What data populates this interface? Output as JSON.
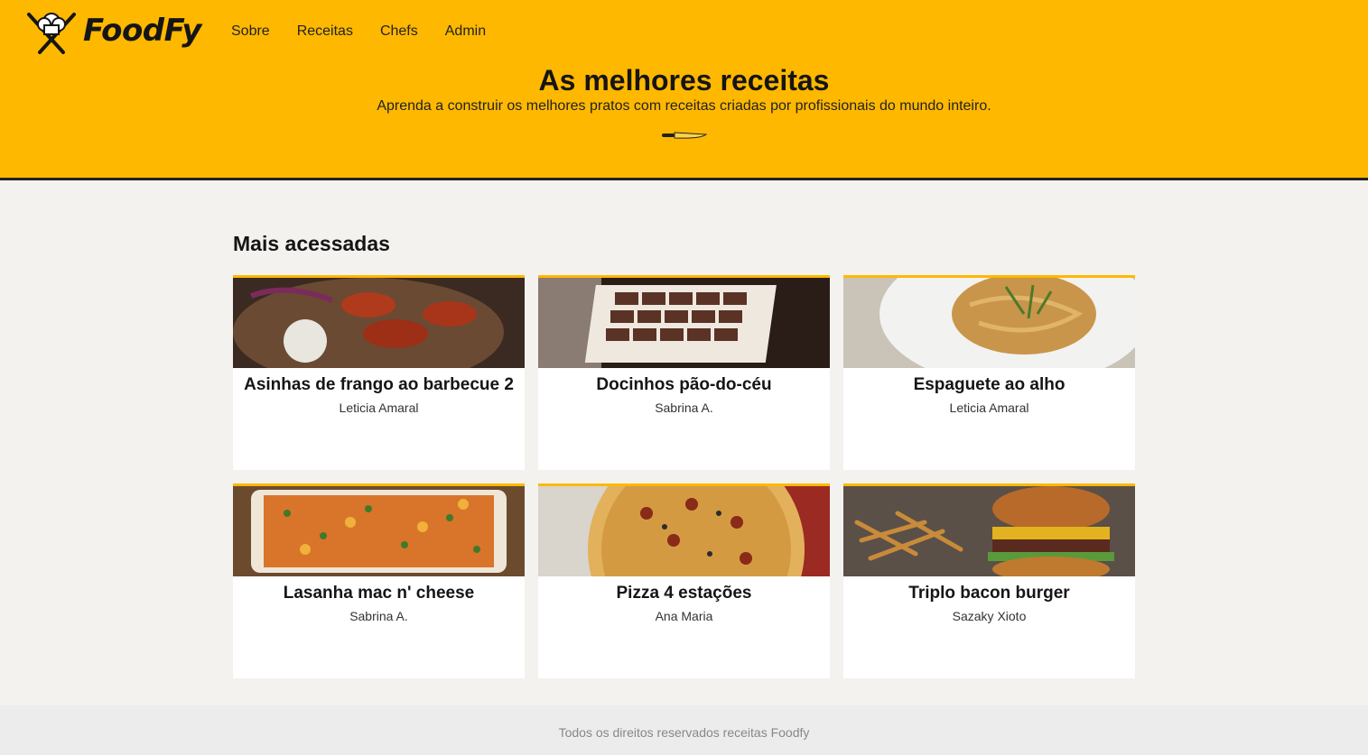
{
  "header": {
    "logo_text": "FoodFy",
    "nav": [
      "Sobre",
      "Receitas",
      "Chefs",
      "Admin"
    ],
    "title": "As melhores receitas",
    "subtitle": "Aprenda a construir os melhores pratos com receitas criadas por profissionais do mundo inteiro."
  },
  "section": {
    "title": "Mais acessadas"
  },
  "recipes": [
    {
      "title": "Asinhas de frango ao barbecue 2",
      "author": "Leticia Amaral",
      "image": "chicken-wings-photo"
    },
    {
      "title": "Docinhos pão-do-céu",
      "author": "Sabrina A.",
      "image": "chocolate-box-photo"
    },
    {
      "title": "Espaguete ao alho",
      "author": "Leticia Amaral",
      "image": "spaghetti-photo"
    },
    {
      "title": "Lasanha mac n' cheese",
      "author": "Sabrina A.",
      "image": "lasagna-photo"
    },
    {
      "title": "Pizza 4 estações",
      "author": "Ana Maria",
      "image": "pizza-photo"
    },
    {
      "title": "Triplo bacon burger",
      "author": "Sazaky Xioto",
      "image": "burger-photo"
    }
  ],
  "footer": {
    "text": "Todos os direitos reservados receitas Foodfy"
  },
  "colors": {
    "accent": "#ffb800",
    "background": "#f3f2ee",
    "footer": "#ececec"
  }
}
